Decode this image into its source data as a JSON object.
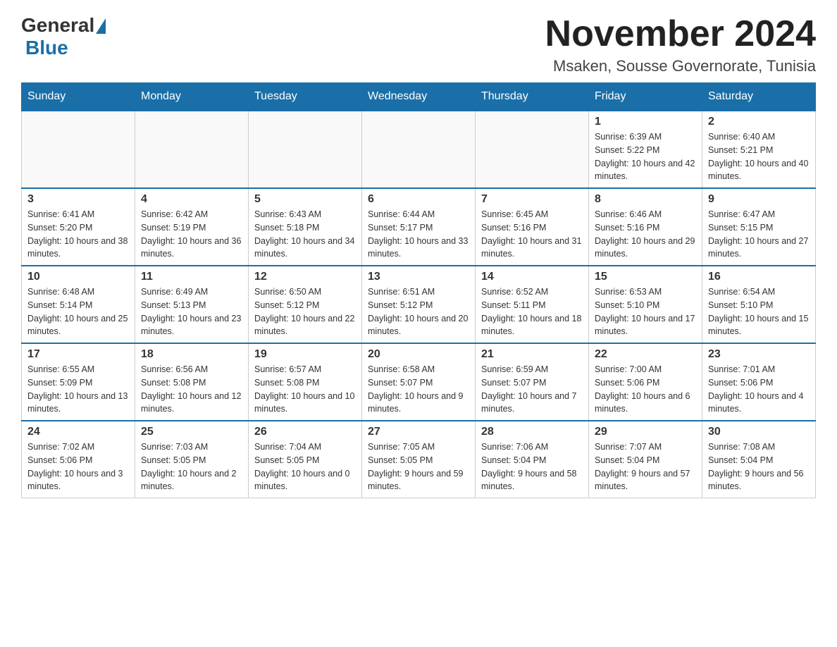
{
  "logo": {
    "general": "General",
    "blue": "Blue"
  },
  "title": "November 2024",
  "subtitle": "Msaken, Sousse Governorate, Tunisia",
  "days_of_week": [
    "Sunday",
    "Monday",
    "Tuesday",
    "Wednesday",
    "Thursday",
    "Friday",
    "Saturday"
  ],
  "weeks": [
    [
      {
        "day": "",
        "info": ""
      },
      {
        "day": "",
        "info": ""
      },
      {
        "day": "",
        "info": ""
      },
      {
        "day": "",
        "info": ""
      },
      {
        "day": "",
        "info": ""
      },
      {
        "day": "1",
        "info": "Sunrise: 6:39 AM\nSunset: 5:22 PM\nDaylight: 10 hours and 42 minutes."
      },
      {
        "day": "2",
        "info": "Sunrise: 6:40 AM\nSunset: 5:21 PM\nDaylight: 10 hours and 40 minutes."
      }
    ],
    [
      {
        "day": "3",
        "info": "Sunrise: 6:41 AM\nSunset: 5:20 PM\nDaylight: 10 hours and 38 minutes."
      },
      {
        "day": "4",
        "info": "Sunrise: 6:42 AM\nSunset: 5:19 PM\nDaylight: 10 hours and 36 minutes."
      },
      {
        "day": "5",
        "info": "Sunrise: 6:43 AM\nSunset: 5:18 PM\nDaylight: 10 hours and 34 minutes."
      },
      {
        "day": "6",
        "info": "Sunrise: 6:44 AM\nSunset: 5:17 PM\nDaylight: 10 hours and 33 minutes."
      },
      {
        "day": "7",
        "info": "Sunrise: 6:45 AM\nSunset: 5:16 PM\nDaylight: 10 hours and 31 minutes."
      },
      {
        "day": "8",
        "info": "Sunrise: 6:46 AM\nSunset: 5:16 PM\nDaylight: 10 hours and 29 minutes."
      },
      {
        "day": "9",
        "info": "Sunrise: 6:47 AM\nSunset: 5:15 PM\nDaylight: 10 hours and 27 minutes."
      }
    ],
    [
      {
        "day": "10",
        "info": "Sunrise: 6:48 AM\nSunset: 5:14 PM\nDaylight: 10 hours and 25 minutes."
      },
      {
        "day": "11",
        "info": "Sunrise: 6:49 AM\nSunset: 5:13 PM\nDaylight: 10 hours and 23 minutes."
      },
      {
        "day": "12",
        "info": "Sunrise: 6:50 AM\nSunset: 5:12 PM\nDaylight: 10 hours and 22 minutes."
      },
      {
        "day": "13",
        "info": "Sunrise: 6:51 AM\nSunset: 5:12 PM\nDaylight: 10 hours and 20 minutes."
      },
      {
        "day": "14",
        "info": "Sunrise: 6:52 AM\nSunset: 5:11 PM\nDaylight: 10 hours and 18 minutes."
      },
      {
        "day": "15",
        "info": "Sunrise: 6:53 AM\nSunset: 5:10 PM\nDaylight: 10 hours and 17 minutes."
      },
      {
        "day": "16",
        "info": "Sunrise: 6:54 AM\nSunset: 5:10 PM\nDaylight: 10 hours and 15 minutes."
      }
    ],
    [
      {
        "day": "17",
        "info": "Sunrise: 6:55 AM\nSunset: 5:09 PM\nDaylight: 10 hours and 13 minutes."
      },
      {
        "day": "18",
        "info": "Sunrise: 6:56 AM\nSunset: 5:08 PM\nDaylight: 10 hours and 12 minutes."
      },
      {
        "day": "19",
        "info": "Sunrise: 6:57 AM\nSunset: 5:08 PM\nDaylight: 10 hours and 10 minutes."
      },
      {
        "day": "20",
        "info": "Sunrise: 6:58 AM\nSunset: 5:07 PM\nDaylight: 10 hours and 9 minutes."
      },
      {
        "day": "21",
        "info": "Sunrise: 6:59 AM\nSunset: 5:07 PM\nDaylight: 10 hours and 7 minutes."
      },
      {
        "day": "22",
        "info": "Sunrise: 7:00 AM\nSunset: 5:06 PM\nDaylight: 10 hours and 6 minutes."
      },
      {
        "day": "23",
        "info": "Sunrise: 7:01 AM\nSunset: 5:06 PM\nDaylight: 10 hours and 4 minutes."
      }
    ],
    [
      {
        "day": "24",
        "info": "Sunrise: 7:02 AM\nSunset: 5:06 PM\nDaylight: 10 hours and 3 minutes."
      },
      {
        "day": "25",
        "info": "Sunrise: 7:03 AM\nSunset: 5:05 PM\nDaylight: 10 hours and 2 minutes."
      },
      {
        "day": "26",
        "info": "Sunrise: 7:04 AM\nSunset: 5:05 PM\nDaylight: 10 hours and 0 minutes."
      },
      {
        "day": "27",
        "info": "Sunrise: 7:05 AM\nSunset: 5:05 PM\nDaylight: 9 hours and 59 minutes."
      },
      {
        "day": "28",
        "info": "Sunrise: 7:06 AM\nSunset: 5:04 PM\nDaylight: 9 hours and 58 minutes."
      },
      {
        "day": "29",
        "info": "Sunrise: 7:07 AM\nSunset: 5:04 PM\nDaylight: 9 hours and 57 minutes."
      },
      {
        "day": "30",
        "info": "Sunrise: 7:08 AM\nSunset: 5:04 PM\nDaylight: 9 hours and 56 minutes."
      }
    ]
  ]
}
